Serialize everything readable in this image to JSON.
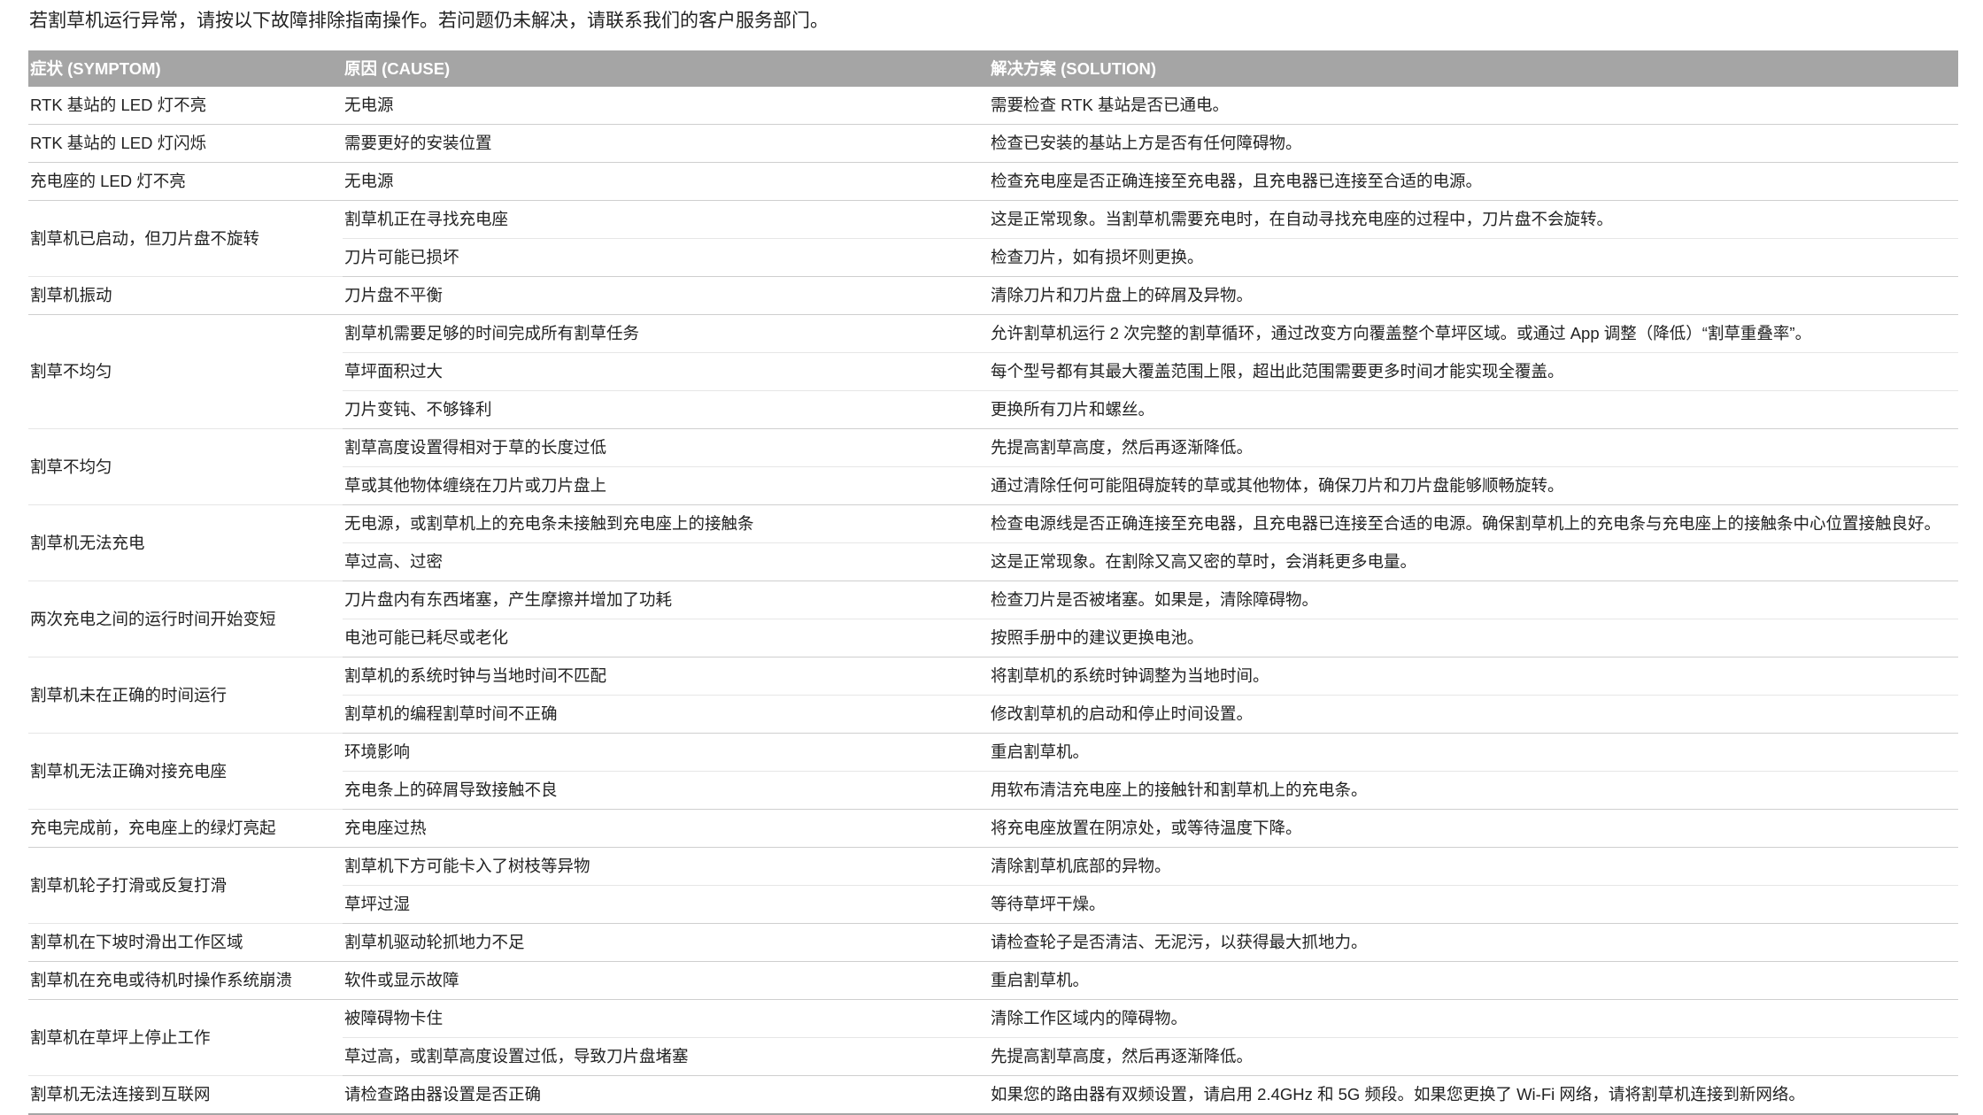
{
  "intro": "若割草机运行异常，请按以下故障排除指南操作。若问题仍未解决，请联系我们的客户服务部门。",
  "table": {
    "headers": [
      "症状 (SYMPTOM)",
      "原因 (CAUSE)",
      "解决方案 (SOLUTION)"
    ],
    "groups": [
      {
        "symptom": "RTK 基站的 LED 灯不亮",
        "rows": [
          {
            "cause": "无电源",
            "solution": "需要检查 RTK 基站是否已通电。"
          }
        ]
      },
      {
        "symptom": "RTK 基站的 LED 灯闪烁",
        "rows": [
          {
            "cause": "需要更好的安装位置",
            "solution": "检查已安装的基站上方是否有任何障碍物。"
          }
        ]
      },
      {
        "symptom": "充电座的 LED 灯不亮",
        "rows": [
          {
            "cause": "无电源",
            "solution": "检查充电座是否正确连接至充电器，且充电器已连接至合适的电源。"
          }
        ]
      },
      {
        "symptom": "割草机已启动，但刀片盘不旋转",
        "rows": [
          {
            "cause": "割草机正在寻找充电座",
            "solution": "这是正常现象。当割草机需要充电时，在自动寻找充电座的过程中，刀片盘不会旋转。"
          },
          {
            "cause": "刀片可能已损坏",
            "solution": "检查刀片，如有损坏则更换。"
          }
        ]
      },
      {
        "symptom": "割草机振动",
        "rows": [
          {
            "cause": "刀片盘不平衡",
            "solution": "清除刀片和刀片盘上的碎屑及异物。"
          }
        ]
      },
      {
        "symptom": "割草不均匀",
        "rows": [
          {
            "cause": "割草机需要足够的时间完成所有割草任务",
            "solution": "允许割草机运行 2 次完整的割草循环，通过改变方向覆盖整个草坪区域。或通过 App 调整（降低）“割草重叠率”。"
          },
          {
            "cause": "草坪面积过大",
            "solution": "每个型号都有其最大覆盖范围上限，超出此范围需要更多时间才能实现全覆盖。"
          },
          {
            "cause": "刀片变钝、不够锋利",
            "solution": "更换所有刀片和螺丝。"
          }
        ]
      },
      {
        "symptom": "割草不均匀",
        "rows": [
          {
            "cause": "割草高度设置得相对于草的长度过低",
            "solution": "先提高割草高度，然后再逐渐降低。"
          },
          {
            "cause": "草或其他物体缠绕在刀片或刀片盘上",
            "solution": "通过清除任何可能阻碍旋转的草或其他物体，确保刀片和刀片盘能够顺畅旋转。"
          }
        ]
      },
      {
        "symptom": "割草机无法充电",
        "rows": [
          {
            "cause": "无电源，或割草机上的充电条未接触到充电座上的接触条",
            "solution": "检查电源线是否正确连接至充电器，且充电器已连接至合适的电源。确保割草机上的充电条与充电座上的接触条中心位置接触良好。"
          },
          {
            "cause": "草过高、过密",
            "solution": "这是正常现象。在割除又高又密的草时，会消耗更多电量。"
          }
        ]
      },
      {
        "symptom": "两次充电之间的运行时间开始变短",
        "rows": [
          {
            "cause": "刀片盘内有东西堵塞，产生摩擦并增加了功耗",
            "solution": "检查刀片是否被堵塞。如果是，清除障碍物。"
          },
          {
            "cause": "电池可能已耗尽或老化",
            "solution": "按照手册中的建议更换电池。"
          }
        ]
      },
      {
        "symptom": "割草机未在正确的时间运行",
        "rows": [
          {
            "cause": "割草机的系统时钟与当地时间不匹配",
            "solution": "将割草机的系统时钟调整为当地时间。"
          },
          {
            "cause": "割草机的编程割草时间不正确",
            "solution": "修改割草机的启动和停止时间设置。"
          }
        ]
      },
      {
        "symptom": "割草机无法正确对接充电座",
        "rows": [
          {
            "cause": "环境影响",
            "solution": "重启割草机。"
          },
          {
            "cause": "充电条上的碎屑导致接触不良",
            "solution": "用软布清洁充电座上的接触针和割草机上的充电条。"
          }
        ]
      },
      {
        "symptom": "充电完成前，充电座上的绿灯亮起",
        "rows": [
          {
            "cause": "充电座过热",
            "solution": "将充电座放置在阴凉处，或等待温度下降。"
          }
        ]
      },
      {
        "symptom": "割草机轮子打滑或反复打滑",
        "rows": [
          {
            "cause": "割草机下方可能卡入了树枝等异物",
            "solution": "清除割草机底部的异物。"
          },
          {
            "cause": "草坪过湿",
            "solution": "等待草坪干燥。"
          }
        ]
      },
      {
        "symptom": "割草机在下坡时滑出工作区域",
        "rows": [
          {
            "cause": "割草机驱动轮抓地力不足",
            "solution": "请检查轮子是否清洁、无泥污，以获得最大抓地力。"
          }
        ]
      },
      {
        "symptom": "割草机在充电或待机时操作系统崩溃",
        "rows": [
          {
            "cause": "软件或显示故障",
            "solution": "重启割草机。"
          }
        ]
      },
      {
        "symptom": "割草机在草坪上停止工作",
        "rows": [
          {
            "cause": "被障碍物卡住",
            "solution": "清除工作区域内的障碍物。"
          },
          {
            "cause": "草过高，或割草高度设置过低，导致刀片盘堵塞",
            "solution": "先提高割草高度，然后再逐渐降低。"
          }
        ]
      },
      {
        "symptom": "割草机无法连接到互联网",
        "rows": [
          {
            "cause": "请检查路由器设置是否正确",
            "solution": "如果您的路由器有双频设置，请启用 2.4GHz 和 5G 频段。如果您更换了 Wi-Fi 网络，请将割草机连接到新网络。"
          }
        ]
      }
    ]
  }
}
